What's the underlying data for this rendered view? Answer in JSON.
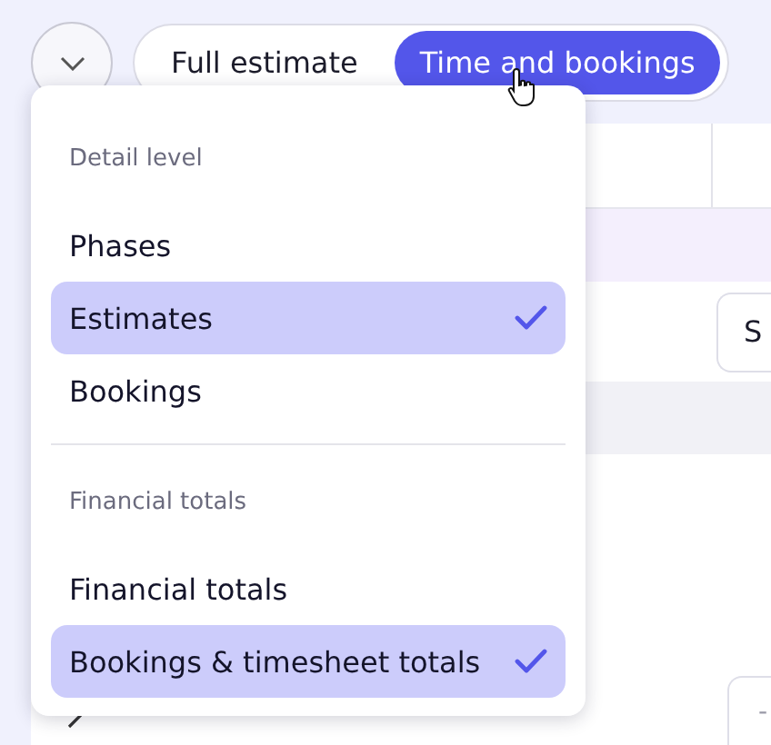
{
  "view_toggle": {
    "options": [
      {
        "label": "Full estimate",
        "selected": false
      },
      {
        "label": "Time and bookings",
        "selected": true
      }
    ]
  },
  "menu": {
    "sections": [
      {
        "heading": "Detail level",
        "items": [
          {
            "label": "Phases",
            "checked": false
          },
          {
            "label": "Estimates",
            "checked": true
          },
          {
            "label": "Bookings",
            "checked": false
          }
        ]
      },
      {
        "heading": "Financial totals",
        "items": [
          {
            "label": "Financial totals",
            "checked": false
          },
          {
            "label": "Bookings & timesheet totals",
            "checked": true
          }
        ]
      }
    ]
  },
  "table": {
    "task_field": "S",
    "item": {
      "value": "-"
    }
  }
}
